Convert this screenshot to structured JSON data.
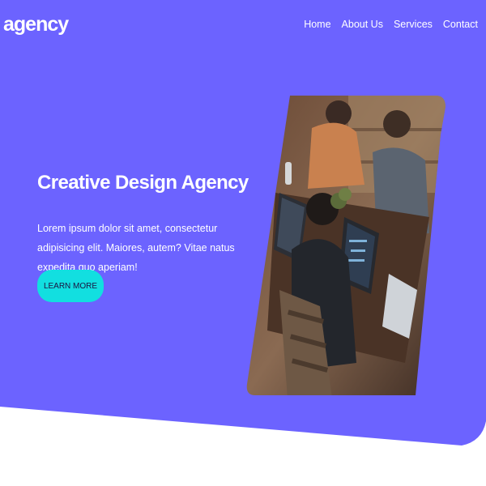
{
  "brand": {
    "logo": "agency"
  },
  "nav": {
    "items": [
      {
        "label": "Home"
      },
      {
        "label": "About Us"
      },
      {
        "label": "Services"
      },
      {
        "label": "Contact"
      }
    ]
  },
  "hero": {
    "title": "Creative Design Agency",
    "text": "Lorem ipsum dolor sit amet, consectetur adipisicing elit. Maiores, autem? Vitae natus expedita quo aperiam!",
    "cta_label": "LEARN MORE",
    "image_description": "team working on laptops"
  },
  "colors": {
    "primary": "#6c63ff",
    "accent": "#12dfe0",
    "background": "#ffffff"
  }
}
